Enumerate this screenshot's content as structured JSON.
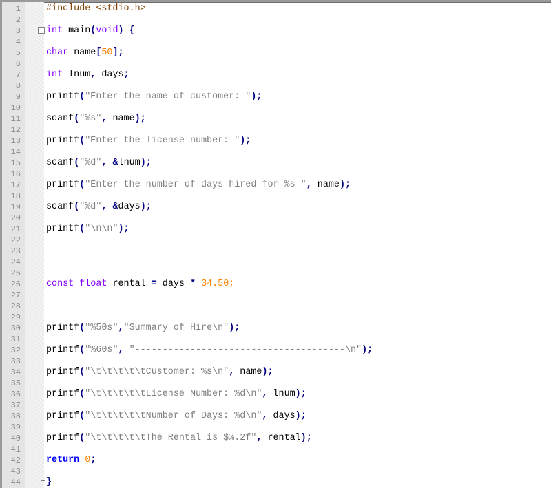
{
  "editor": {
    "colors": {
      "preprocessor": "#804000",
      "type": "#8000ff",
      "keyword": "#0000ff",
      "operator": "#000080",
      "string": "#808080",
      "number": "#ff8000",
      "identifier": "#000000",
      "gutter": "#e4e4e4",
      "line_number": "#8a8a8a"
    },
    "fold_marker": "minus-box",
    "lines": [
      {
        "n": "1",
        "tokens": [
          {
            "t": "pre",
            "v": "#include <stdio.h>"
          }
        ]
      },
      {
        "n": "2",
        "tokens": []
      },
      {
        "n": "3",
        "tokens": [
          {
            "t": "type",
            "v": "int"
          },
          {
            "t": "id",
            "v": " main"
          },
          {
            "t": "op",
            "v": "("
          },
          {
            "t": "type",
            "v": "void"
          },
          {
            "t": "op",
            "v": ")"
          },
          {
            "t": "id",
            "v": " "
          },
          {
            "t": "op",
            "v": "{"
          }
        ]
      },
      {
        "n": "4",
        "tokens": []
      },
      {
        "n": "5",
        "tokens": [
          {
            "t": "type",
            "v": "char"
          },
          {
            "t": "id",
            "v": " name"
          },
          {
            "t": "op",
            "v": "["
          },
          {
            "t": "num",
            "v": "50"
          },
          {
            "t": "op",
            "v": "];"
          }
        ]
      },
      {
        "n": "6",
        "tokens": []
      },
      {
        "n": "7",
        "tokens": [
          {
            "t": "type",
            "v": "int"
          },
          {
            "t": "id",
            "v": " lnum"
          },
          {
            "t": "op",
            "v": ","
          },
          {
            "t": "id",
            "v": " days"
          },
          {
            "t": "op",
            "v": ";"
          }
        ]
      },
      {
        "n": "8",
        "tokens": []
      },
      {
        "n": "9",
        "tokens": [
          {
            "t": "id",
            "v": "printf"
          },
          {
            "t": "op",
            "v": "("
          },
          {
            "t": "str",
            "v": "\"Enter the name of customer: \""
          },
          {
            "t": "op",
            "v": ");"
          }
        ]
      },
      {
        "n": "10",
        "tokens": []
      },
      {
        "n": "11",
        "tokens": [
          {
            "t": "id",
            "v": "scanf"
          },
          {
            "t": "op",
            "v": "("
          },
          {
            "t": "str",
            "v": "\"%s\""
          },
          {
            "t": "op",
            "v": ","
          },
          {
            "t": "id",
            "v": " name"
          },
          {
            "t": "op",
            "v": ");"
          }
        ]
      },
      {
        "n": "12",
        "tokens": []
      },
      {
        "n": "13",
        "tokens": [
          {
            "t": "id",
            "v": "printf"
          },
          {
            "t": "op",
            "v": "("
          },
          {
            "t": "str",
            "v": "\"Enter the license number: \""
          },
          {
            "t": "op",
            "v": ");"
          }
        ]
      },
      {
        "n": "14",
        "tokens": []
      },
      {
        "n": "15",
        "tokens": [
          {
            "t": "id",
            "v": "scanf"
          },
          {
            "t": "op",
            "v": "("
          },
          {
            "t": "str",
            "v": "\"%d\""
          },
          {
            "t": "op",
            "v": ","
          },
          {
            "t": "id",
            "v": " "
          },
          {
            "t": "op",
            "v": "&"
          },
          {
            "t": "id",
            "v": "lnum"
          },
          {
            "t": "op",
            "v": ");"
          }
        ]
      },
      {
        "n": "16",
        "tokens": []
      },
      {
        "n": "17",
        "tokens": [
          {
            "t": "id",
            "v": "printf"
          },
          {
            "t": "op",
            "v": "("
          },
          {
            "t": "str",
            "v": "\"Enter the number of days hired for %s \""
          },
          {
            "t": "op",
            "v": ","
          },
          {
            "t": "id",
            "v": " name"
          },
          {
            "t": "op",
            "v": ");"
          }
        ]
      },
      {
        "n": "18",
        "tokens": []
      },
      {
        "n": "19",
        "tokens": [
          {
            "t": "id",
            "v": "scanf"
          },
          {
            "t": "op",
            "v": "("
          },
          {
            "t": "str",
            "v": "\"%d\""
          },
          {
            "t": "op",
            "v": ","
          },
          {
            "t": "id",
            "v": " "
          },
          {
            "t": "op",
            "v": "&"
          },
          {
            "t": "id",
            "v": "days"
          },
          {
            "t": "op",
            "v": ");"
          }
        ]
      },
      {
        "n": "20",
        "tokens": []
      },
      {
        "n": "21",
        "tokens": [
          {
            "t": "id",
            "v": "printf"
          },
          {
            "t": "op",
            "v": "("
          },
          {
            "t": "str",
            "v": "\"\\n\\n\""
          },
          {
            "t": "op",
            "v": ");"
          }
        ]
      },
      {
        "n": "22",
        "tokens": []
      },
      {
        "n": "23",
        "tokens": []
      },
      {
        "n": "24",
        "tokens": []
      },
      {
        "n": "25",
        "tokens": []
      },
      {
        "n": "26",
        "tokens": [
          {
            "t": "type",
            "v": "const"
          },
          {
            "t": "id",
            "v": " "
          },
          {
            "t": "type",
            "v": "float"
          },
          {
            "t": "id",
            "v": " rental "
          },
          {
            "t": "op",
            "v": "="
          },
          {
            "t": "id",
            "v": " days "
          },
          {
            "t": "op",
            "v": "*"
          },
          {
            "t": "id",
            "v": " "
          },
          {
            "t": "num",
            "v": "34.50"
          },
          {
            "t": "num",
            "v": ";"
          }
        ]
      },
      {
        "n": "27",
        "tokens": []
      },
      {
        "n": "28",
        "tokens": []
      },
      {
        "n": "29",
        "tokens": []
      },
      {
        "n": "30",
        "tokens": [
          {
            "t": "id",
            "v": "printf"
          },
          {
            "t": "op",
            "v": "("
          },
          {
            "t": "str",
            "v": "\"%50s\""
          },
          {
            "t": "op",
            "v": ","
          },
          {
            "t": "str",
            "v": "\"Summary of Hire\\n\""
          },
          {
            "t": "op",
            "v": ");"
          }
        ]
      },
      {
        "n": "31",
        "tokens": []
      },
      {
        "n": "32",
        "tokens": [
          {
            "t": "id",
            "v": "printf"
          },
          {
            "t": "op",
            "v": "("
          },
          {
            "t": "str",
            "v": "\"%60s\""
          },
          {
            "t": "op",
            "v": ","
          },
          {
            "t": "id",
            "v": " "
          },
          {
            "t": "str",
            "v": "\"--------------------------------------\\n\""
          },
          {
            "t": "op",
            "v": ");"
          }
        ]
      },
      {
        "n": "33",
        "tokens": []
      },
      {
        "n": "34",
        "tokens": [
          {
            "t": "id",
            "v": "printf"
          },
          {
            "t": "op",
            "v": "("
          },
          {
            "t": "str",
            "v": "\"\\t\\t\\t\\t\\tCustomer: %s\\n\""
          },
          {
            "t": "op",
            "v": ","
          },
          {
            "t": "id",
            "v": " name"
          },
          {
            "t": "op",
            "v": ");"
          }
        ]
      },
      {
        "n": "35",
        "tokens": []
      },
      {
        "n": "36",
        "tokens": [
          {
            "t": "id",
            "v": "printf"
          },
          {
            "t": "op",
            "v": "("
          },
          {
            "t": "str",
            "v": "\"\\t\\t\\t\\t\\tLicense Number: %d\\n\""
          },
          {
            "t": "op",
            "v": ","
          },
          {
            "t": "id",
            "v": " lnum"
          },
          {
            "t": "op",
            "v": ");"
          }
        ]
      },
      {
        "n": "37",
        "tokens": []
      },
      {
        "n": "38",
        "tokens": [
          {
            "t": "id",
            "v": "printf"
          },
          {
            "t": "op",
            "v": "("
          },
          {
            "t": "str",
            "v": "\"\\t\\t\\t\\t\\tNumber of Days: %d\\n\""
          },
          {
            "t": "op",
            "v": ","
          },
          {
            "t": "id",
            "v": " days"
          },
          {
            "t": "op",
            "v": ");"
          }
        ]
      },
      {
        "n": "39",
        "tokens": []
      },
      {
        "n": "40",
        "tokens": [
          {
            "t": "id",
            "v": "printf"
          },
          {
            "t": "op",
            "v": "("
          },
          {
            "t": "str",
            "v": "\"\\t\\t\\t\\t\\tThe Rental is $%.2f\""
          },
          {
            "t": "op",
            "v": ","
          },
          {
            "t": "id",
            "v": " rental"
          },
          {
            "t": "op",
            "v": ");"
          }
        ]
      },
      {
        "n": "41",
        "tokens": []
      },
      {
        "n": "42",
        "tokens": [
          {
            "t": "kw",
            "v": "return"
          },
          {
            "t": "id",
            "v": " "
          },
          {
            "t": "num",
            "v": "0"
          },
          {
            "t": "op",
            "v": ";"
          }
        ]
      },
      {
        "n": "43",
        "tokens": []
      },
      {
        "n": "44",
        "tokens": [
          {
            "t": "op",
            "v": "}"
          }
        ]
      }
    ]
  }
}
